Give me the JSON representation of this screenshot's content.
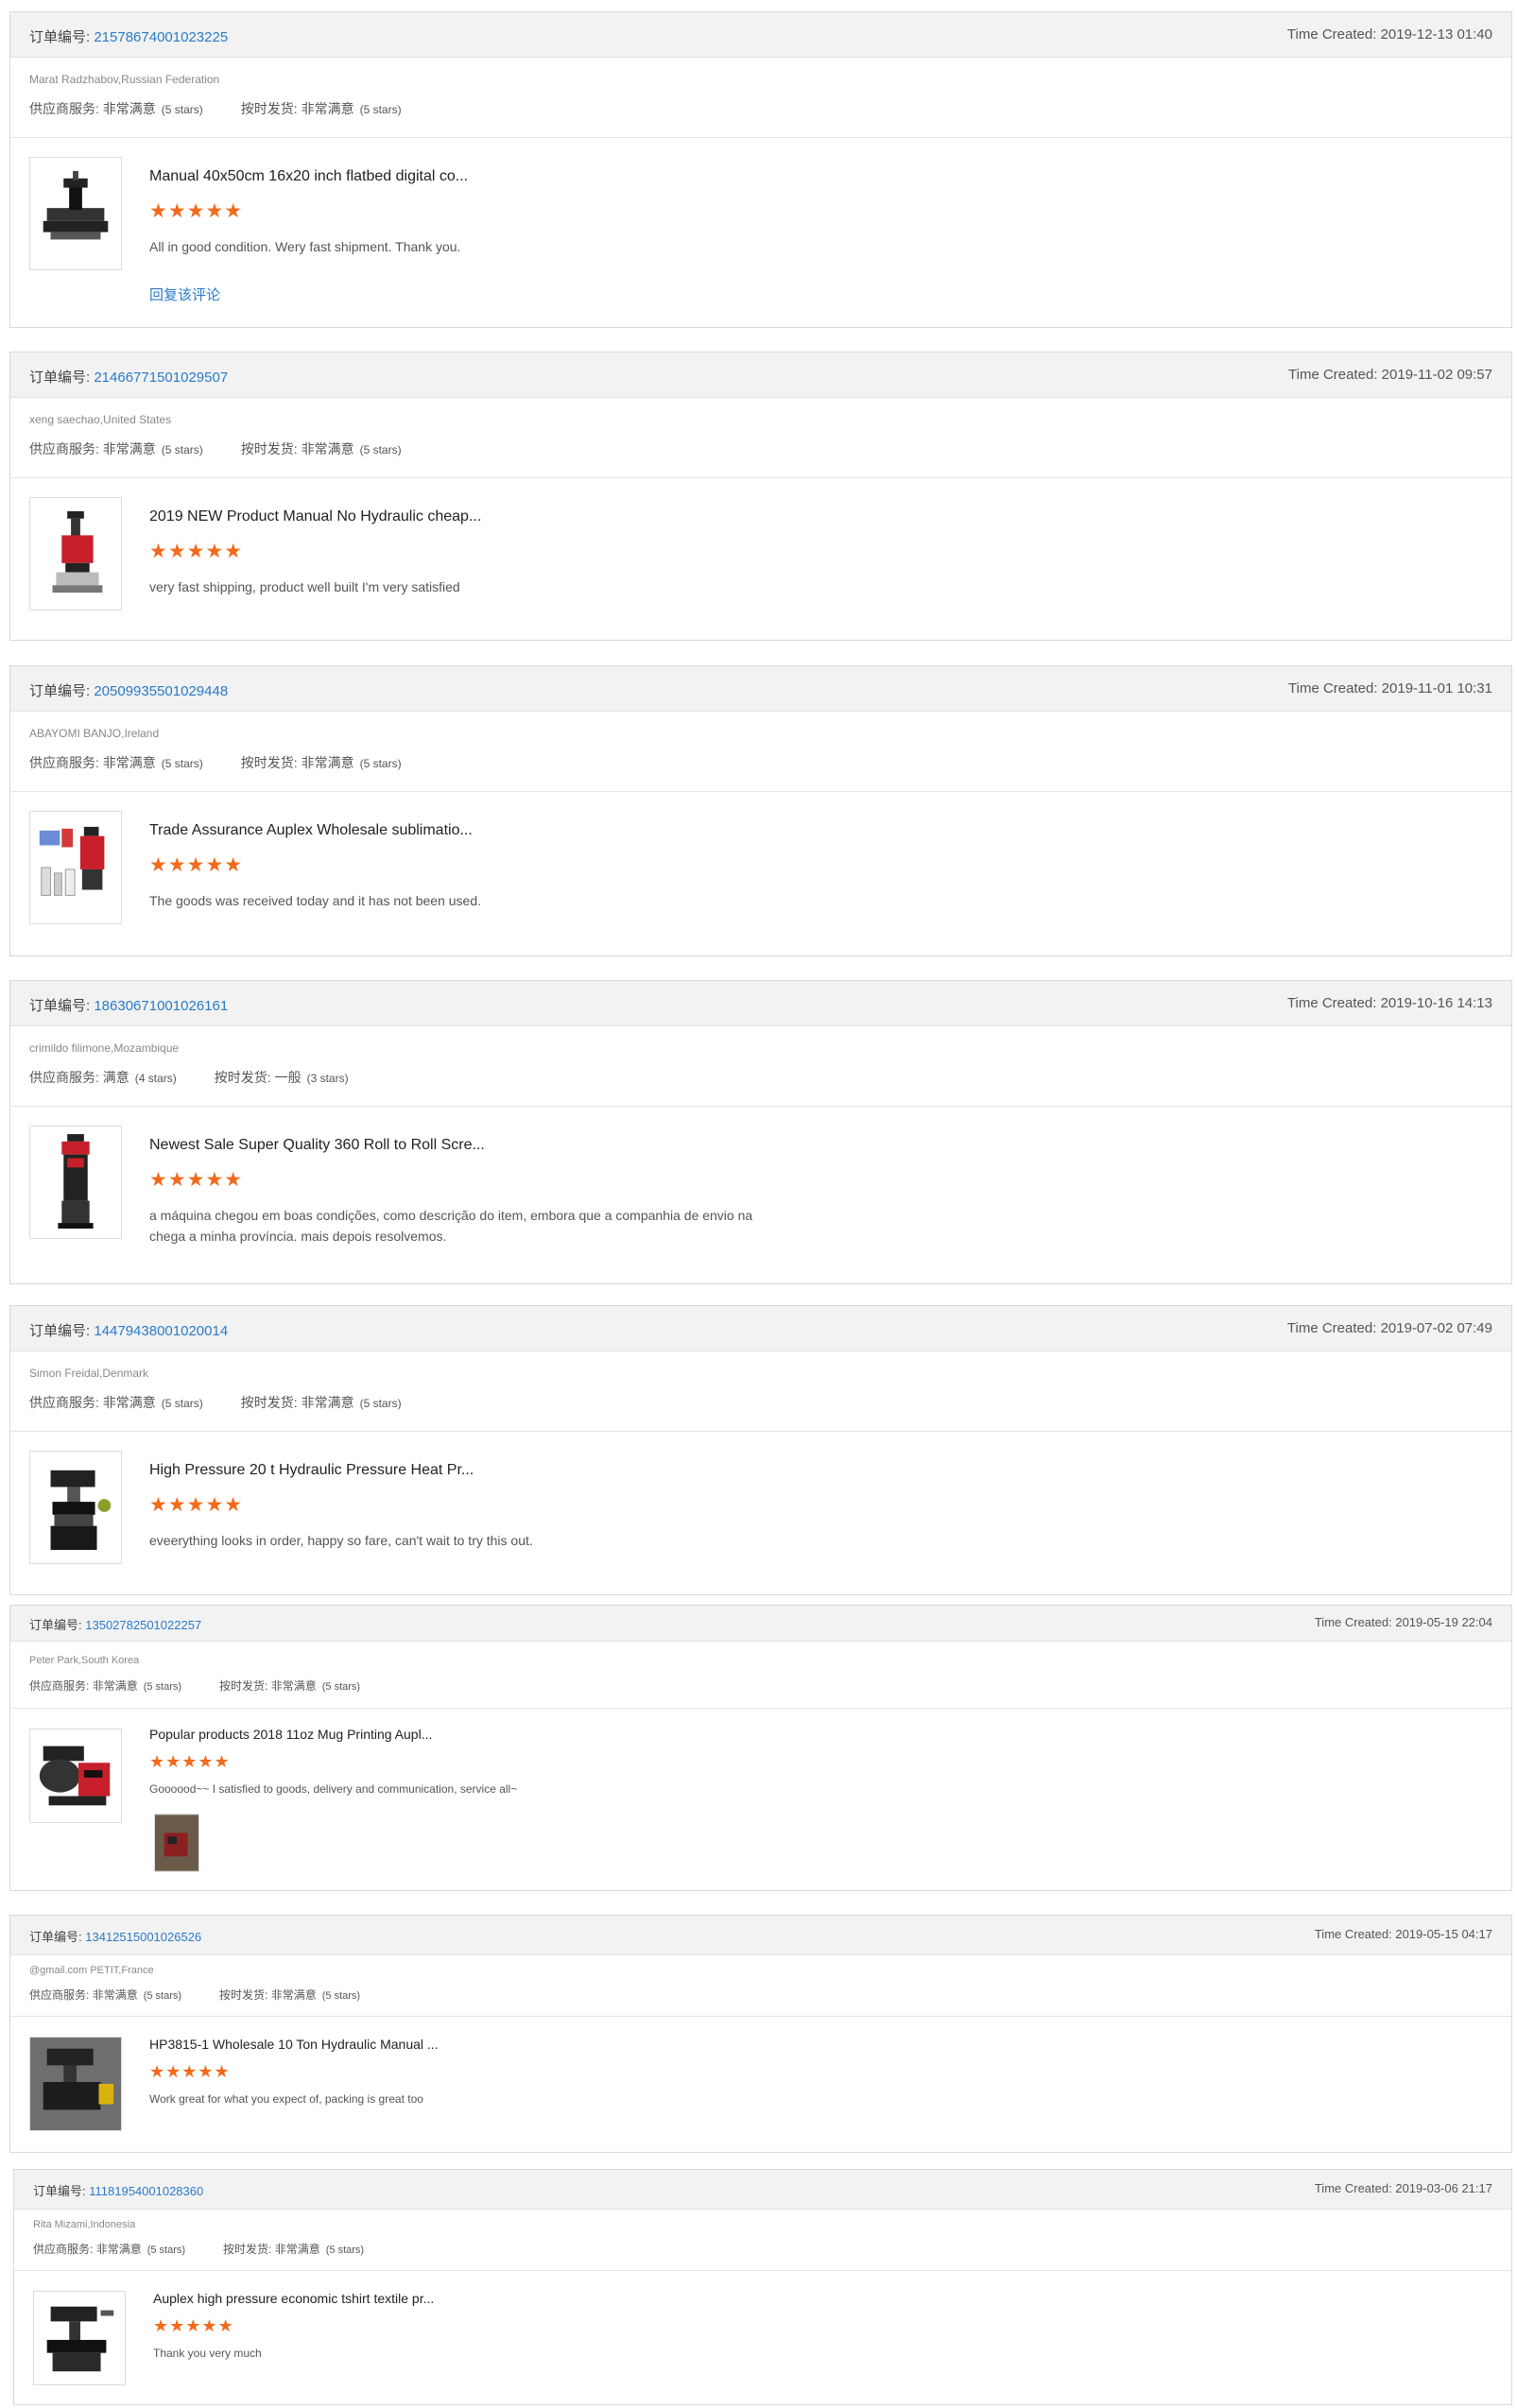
{
  "labels": {
    "order": "订单编号:",
    "time_prefix": "Time Created: ",
    "supplier_service": "供应商服务:",
    "on_time": "按时发货:",
    "reply": "回复该评论"
  },
  "colors": {
    "link": "#2a7ac9",
    "star": "#f26a1b",
    "header_bg": "#f2f2f2"
  },
  "reviews": [
    {
      "order_number": "21578674001023225",
      "time": "2019-12-13 01:40",
      "buyer": "Marat Radzhabov,Russian Federation",
      "supplier_value": "非常满意",
      "supplier_stars": "(5 stars)",
      "ontime_value": "非常满意",
      "ontime_stars": "(5 stars)",
      "title": "Manual 40x50cm 16x20 inch flatbed digital co...",
      "stars": "★★★★★",
      "comment": "All in good condition. Wery fast shipment. Thank you.",
      "reply": "回复该评论",
      "thumb_icon": "flatbed-press-icon"
    },
    {
      "order_number": "21466771501029507",
      "time": "2019-11-02 09:57",
      "buyer": "xeng saechao,United States",
      "supplier_value": "非常满意",
      "supplier_stars": "(5 stars)",
      "ontime_value": "非常满意",
      "ontime_stars": "(5 stars)",
      "title": "2019 NEW Product Manual No Hydraulic cheap...",
      "stars": "★★★★★",
      "comment": "very fast shipping, product well built I'm very satisfied",
      "thumb_icon": "rosin-press-icon"
    },
    {
      "order_number": "20509935501029448",
      "time": "2019-11-01 10:31",
      "buyer": "ABAYOMI BANJO,Ireland",
      "supplier_value": "非常满意",
      "supplier_stars": "(5 stars)",
      "ontime_value": "非常满意",
      "ontime_stars": "(5 stars)",
      "title": "Trade Assurance Auplex Wholesale sublimatio...",
      "stars": "★★★★★",
      "comment": "The goods was received today and it has not been used.",
      "thumb_icon": "sublimation-kit-icon"
    },
    {
      "order_number": "18630671001026161",
      "time": "2019-10-16 14:13",
      "buyer": "crimildo filimone,Mozambique",
      "supplier_value": "满意",
      "supplier_stars": "(4 stars)",
      "ontime_value": "一般",
      "ontime_stars": "(3 stars)",
      "title": "Newest Sale Super Quality 360 Roll to Roll Scre...",
      "stars": "★★★★★",
      "comment": "a máquina chegou em boas condições, como descrição do item, embora que a companhia de envio na chega a minha província. mais depois resolvemos.",
      "thumb_icon": "roll-press-icon"
    },
    {
      "order_number": "14479438001020014",
      "time": "2019-07-02 07:49",
      "buyer": "Simon Freidal,Denmark",
      "supplier_value": "非常满意",
      "supplier_stars": "(5 stars)",
      "ontime_value": "非常满意",
      "ontime_stars": "(5 stars)",
      "title": "High Pressure 20 t Hydraulic Pressure Heat Pr...",
      "stars": "★★★★★",
      "comment": "eveerything looks in order, happy so fare, can't wait to try this out.",
      "thumb_icon": "hydraulic-press-icon"
    },
    {
      "order_number": "13502782501022257",
      "time": "2019-05-19 22:04",
      "buyer": "Peter Park,South Korea",
      "supplier_value": "非常满意",
      "supplier_stars": "(5 stars)",
      "ontime_value": "非常满意",
      "ontime_stars": "(5 stars)",
      "title": "Popular products 2018 11oz Mug Printing Aupl...",
      "stars": "★★★★★",
      "comment": "Goooood~~ I satisfied to goods, delivery and communication, service all~",
      "thumb_icon": "mug-press-icon",
      "review_image": "customer-photo-icon"
    },
    {
      "order_number": "13412515001026526",
      "time": "2019-05-15 04:17",
      "buyer": "@gmail.com PETIT,France",
      "supplier_value": "非常满意",
      "supplier_stars": "(5 stars)",
      "ontime_value": "非常满意",
      "ontime_stars": "(5 stars)",
      "title": "HP3815-1 Wholesale 10 Ton Hydraulic Manual ...",
      "stars": "★★★★★",
      "comment": "Work great for what you expect of, packing is great too",
      "thumb_icon": "manual-press-photo-icon"
    },
    {
      "order_number": "11181954001028360",
      "time": "2019-03-06 21:17",
      "buyer": "Rita Mizami,Indonesia",
      "supplier_value": "非常满意",
      "supplier_stars": "(5 stars)",
      "ontime_value": "非常满意",
      "ontime_stars": "(5 stars)",
      "title": "Auplex high pressure economic tshirt textile pr...",
      "stars": "★★★★★",
      "comment": "Thank you very much",
      "thumb_icon": "tshirt-press-icon"
    }
  ]
}
